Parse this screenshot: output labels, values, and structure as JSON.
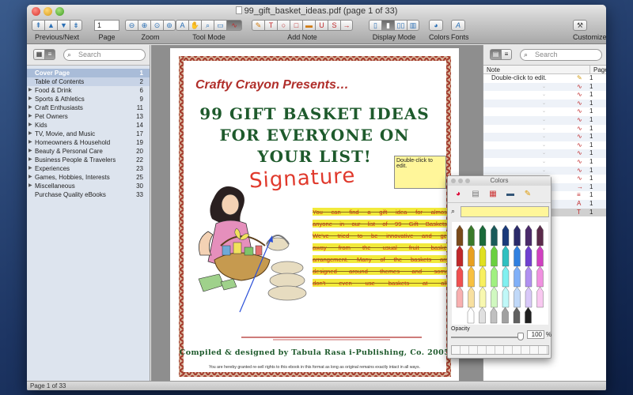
{
  "window": {
    "title": "99_gift_basket_ideas.pdf (page 1 of 33)"
  },
  "toolbar": {
    "prev_next_label": "Previous/Next",
    "page_label": "Page",
    "page_value": "1",
    "zoom_label": "Zoom",
    "tool_mode_label": "Tool Mode",
    "add_note_label": "Add Note",
    "display_mode_label": "Display Mode",
    "colors_label": "Colors",
    "fonts_label": "Fonts",
    "customize_label": "Customize"
  },
  "left_pane": {
    "search_placeholder": "Search",
    "toc": [
      {
        "label": "Cover Page",
        "page": "1"
      },
      {
        "label": "Table of Contents",
        "page": "2"
      },
      {
        "label": "Food & Drink",
        "page": "6"
      },
      {
        "label": "Sports & Athletics",
        "page": "9"
      },
      {
        "label": "Craft Enthusiasts",
        "page": "11"
      },
      {
        "label": "Pet Owners",
        "page": "13"
      },
      {
        "label": "Kids",
        "page": "14"
      },
      {
        "label": "TV, Movie, and Music",
        "page": "17"
      },
      {
        "label": "Homeowners & Household",
        "page": "19"
      },
      {
        "label": "Beauty & Personal Care",
        "page": "20"
      },
      {
        "label": "Business People & Travelers",
        "page": "22"
      },
      {
        "label": "Experiences",
        "page": "23"
      },
      {
        "label": "Games, Hobbies, Interests",
        "page": "25"
      },
      {
        "label": "Miscellaneous",
        "page": "30"
      },
      {
        "label": "Purchase Quality eBooks",
        "page": "33"
      }
    ]
  },
  "page": {
    "kicker": "Crafty Crayon Presents…",
    "title_line1": "99 GIFT BASKET IDEAS",
    "title_line2": "FOR EVERYONE ON",
    "title_line3": "YOUR LIST!",
    "signature": "Signature",
    "note_text": "Double-click to edit.",
    "body_lines": [
      "You can find a gift idea for almost",
      "anyone in our list of 99 Gift Baskets.",
      "We've tried to be innovative and get",
      "away from the usual fruit basket",
      "arrangement. Many of the baskets are",
      "designed around themes and some",
      "don't even use baskets at all!"
    ],
    "credit": "Compiled & designed by Tabula Rasa i-Publishing, Co. 2005",
    "rights": "You are hereby granted re-sell rights to this ebook in this format as long as original remains exactly intact in all ways."
  },
  "right_pane": {
    "search_placeholder": "Search",
    "col_note": "Note",
    "col_page": "Page",
    "rows": [
      {
        "note": "Double-click to edit.",
        "page": "1"
      },
      {
        "note": "",
        "page": "1"
      },
      {
        "note": "",
        "page": "1"
      },
      {
        "note": "",
        "page": "1"
      },
      {
        "note": "",
        "page": "1"
      },
      {
        "note": "",
        "page": "1"
      },
      {
        "note": "",
        "page": "1"
      },
      {
        "note": "",
        "page": "1"
      },
      {
        "note": "",
        "page": "1"
      },
      {
        "note": "",
        "page": "1"
      },
      {
        "note": "",
        "page": "1"
      },
      {
        "note": "",
        "page": "1"
      },
      {
        "note": "",
        "page": "1"
      },
      {
        "note": "",
        "page": "1"
      },
      {
        "note": "",
        "page": "1"
      },
      {
        "note": "",
        "page": "1"
      },
      {
        "note": "",
        "page": "1"
      }
    ],
    "visible_fragments": [
      "dea for",
      "dea for",
      "dea for"
    ]
  },
  "colors_panel": {
    "title": "Colors",
    "opacity_label": "Opacity",
    "opacity_value": "100",
    "opacity_unit": "%",
    "selected_color": "#fff69a"
  },
  "status": {
    "text": "Page 1 of 33"
  },
  "accent_colors": {
    "title_red": "#b02e2a",
    "title_green": "#1e5a2c",
    "highlight": "#f2ea3b",
    "note_yellow": "#fff69a"
  }
}
